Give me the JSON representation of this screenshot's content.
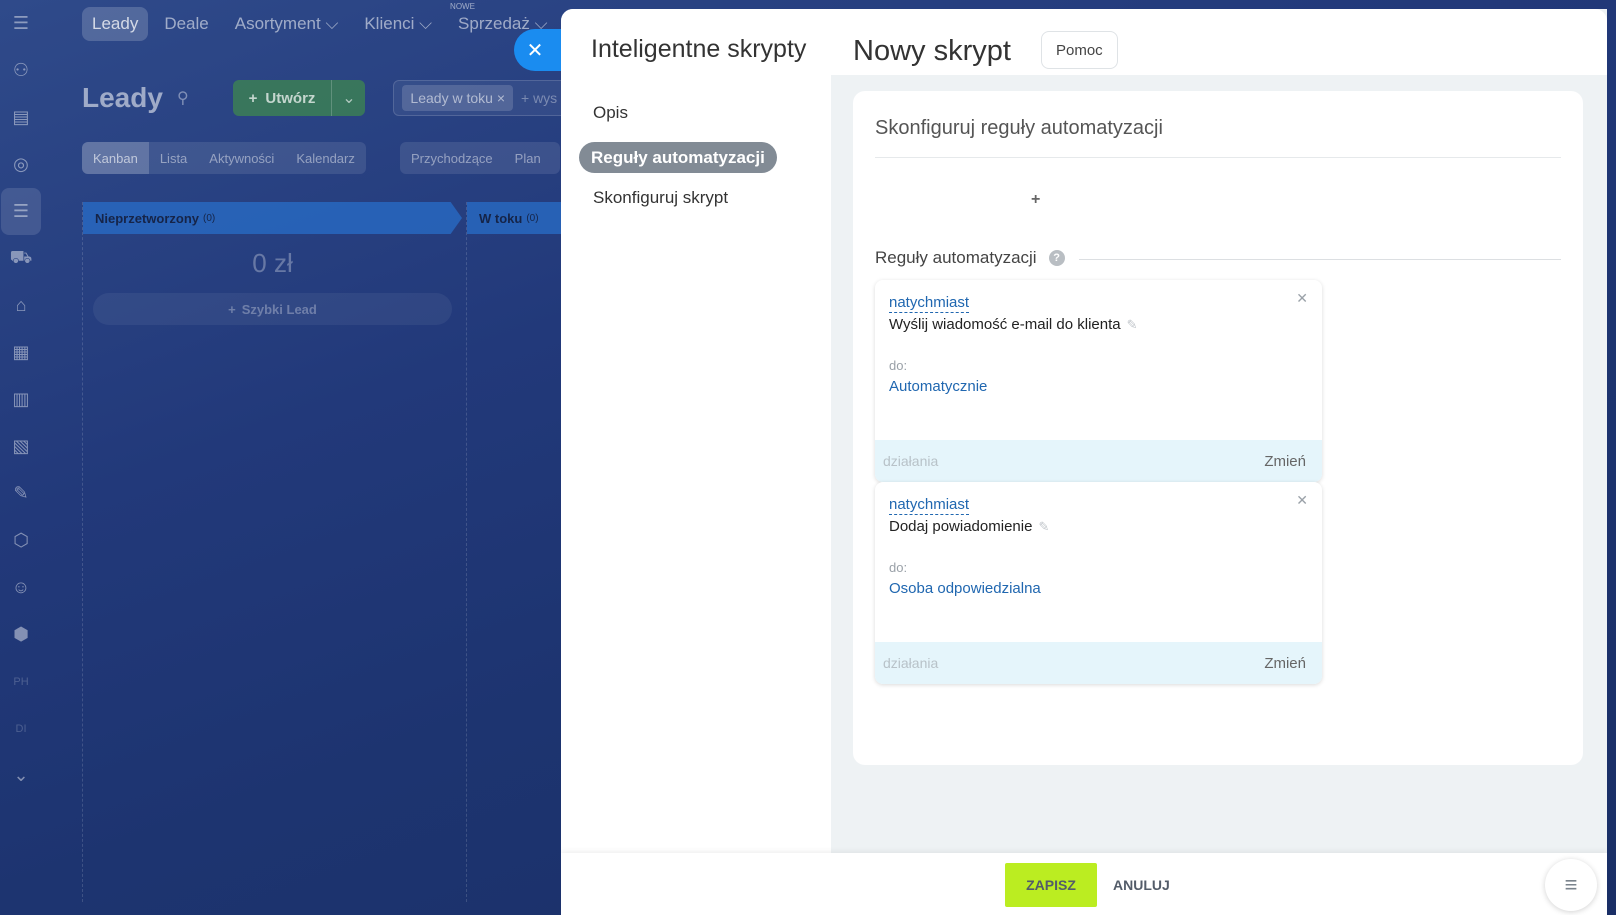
{
  "background": {
    "nav": [
      {
        "label": "Leady",
        "active": true
      },
      {
        "label": "Deale"
      },
      {
        "label": "Asortyment ⌵"
      },
      {
        "label": "Klienci ⌵"
      },
      {
        "label": "Sprzedaż ⌵",
        "tag": "NOWE"
      }
    ],
    "page_title": "Leady",
    "create_label": "Utwórz",
    "filter_chip": "Leady w toku",
    "filter_more": "+ wys",
    "view_tabs": [
      "Kanban",
      "Lista",
      "Aktywności",
      "Kalendarz"
    ],
    "view_tabs2": [
      "Przychodzące",
      "Plan"
    ],
    "columns": [
      {
        "name": "Nieprzetworzony",
        "count": "(0)",
        "sum": "0 zł",
        "quick": "Szybki Lead"
      },
      {
        "name": "W toku",
        "count": "(0)"
      }
    ],
    "rail_small": [
      "PH",
      "DI"
    ]
  },
  "panel": {
    "side_title": "Inteligentne skrypty",
    "side_items": [
      "Opis",
      "Reguły automatyzacji",
      "Skonfiguruj skrypt"
    ],
    "title": "Nowy skrypt",
    "help_label": "Pomoc",
    "card_title": "Skonfiguruj reguły automatyzacji",
    "plus": "+",
    "rules_heading": "Reguły automatyzacji",
    "rules": [
      {
        "when": "natychmiast",
        "name": "Wyślij wiadomość e-mail do klienta",
        "to_label": "do:",
        "to_value": "Automatycznie",
        "actions": "działania",
        "change": "Zmień"
      },
      {
        "when": "natychmiast",
        "name": "Dodaj powiadomienie",
        "to_label": "do:",
        "to_value": "Osoba odpowiedzialna",
        "actions": "działania",
        "change": "Zmień"
      }
    ],
    "save_label": "ZAPISZ",
    "cancel_label": "ANULUJ"
  },
  "colors": {
    "accent_blue": "#1a8cf0",
    "save_green": "#bbed21",
    "link": "#2067b0"
  }
}
